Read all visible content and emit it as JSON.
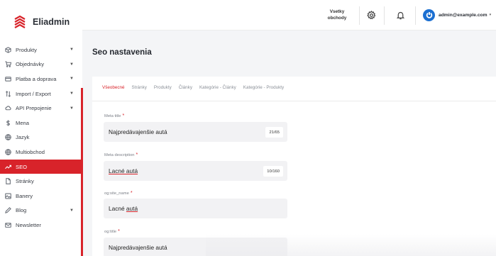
{
  "app": {
    "name": "Eliadmin"
  },
  "colors": {
    "accent": "#d8232a",
    "user_avatar": "#1b6fd1"
  },
  "topbar": {
    "store_select": {
      "line1": "Vsetky",
      "line2": "obchody"
    },
    "settings_icon": "gear-icon",
    "notifications_icon": "bell-icon",
    "user": {
      "email": "admin@example.com",
      "caret": "▾"
    }
  },
  "sidebar": {
    "items": [
      {
        "label": "Produkty",
        "icon": "box-icon",
        "has_submenu": true,
        "active": false
      },
      {
        "label": "Objednávky",
        "icon": "cart-icon",
        "has_submenu": true,
        "active": false
      },
      {
        "label": "Platba a doprava",
        "icon": "card-icon",
        "has_submenu": true,
        "active": false
      },
      {
        "label": "Import / Export",
        "icon": "import-export-icon",
        "has_submenu": true,
        "active": false
      },
      {
        "label": "API Prepojenie",
        "icon": "cloud-icon",
        "has_submenu": true,
        "active": false
      },
      {
        "label": "Mena",
        "icon": "dollar-icon",
        "has_submenu": false,
        "active": false
      },
      {
        "label": "Jazyk",
        "icon": "globe-icon",
        "has_submenu": false,
        "active": false
      },
      {
        "label": "Multiobchod",
        "icon": "globe-icon",
        "has_submenu": false,
        "active": false
      },
      {
        "label": "SEO",
        "icon": "trend-icon",
        "has_submenu": false,
        "active": true
      },
      {
        "label": "Stránky",
        "icon": "file-icon",
        "has_submenu": false,
        "active": false
      },
      {
        "label": "Banery",
        "icon": "image-icon",
        "has_submenu": false,
        "active": false
      },
      {
        "label": "Blog",
        "icon": "pen-icon",
        "has_submenu": true,
        "active": false
      },
      {
        "label": "Newsletter",
        "icon": "mail-icon",
        "has_submenu": false,
        "active": false
      }
    ]
  },
  "main": {
    "title": "Seo nastavenia",
    "tabs": [
      {
        "label": "Všeobecné",
        "active": true
      },
      {
        "label": "Stránky",
        "active": false
      },
      {
        "label": "Produkty",
        "active": false
      },
      {
        "label": "Články",
        "active": false
      },
      {
        "label": "Kategórie - Články",
        "active": false
      },
      {
        "label": "Kategórie - Produkty",
        "active": false
      }
    ],
    "fields": [
      {
        "label": "Meta title",
        "required_mark": "*",
        "value_plain": "Najpredávajenšie autá",
        "value_underlined": "",
        "counter": "21/65"
      },
      {
        "label": "Meta description",
        "required_mark": "*",
        "value_plain": "",
        "value_underlined": "Lacné autá",
        "counter": "10/160"
      },
      {
        "label": "og:site_name",
        "required_mark": "*",
        "value_plain": "Lacné ",
        "value_underlined": "autá",
        "counter": ""
      },
      {
        "label": "og:title",
        "required_mark": "*",
        "value_plain": "Najpredávajenšie autá",
        "value_underlined": "",
        "counter": ""
      }
    ]
  }
}
